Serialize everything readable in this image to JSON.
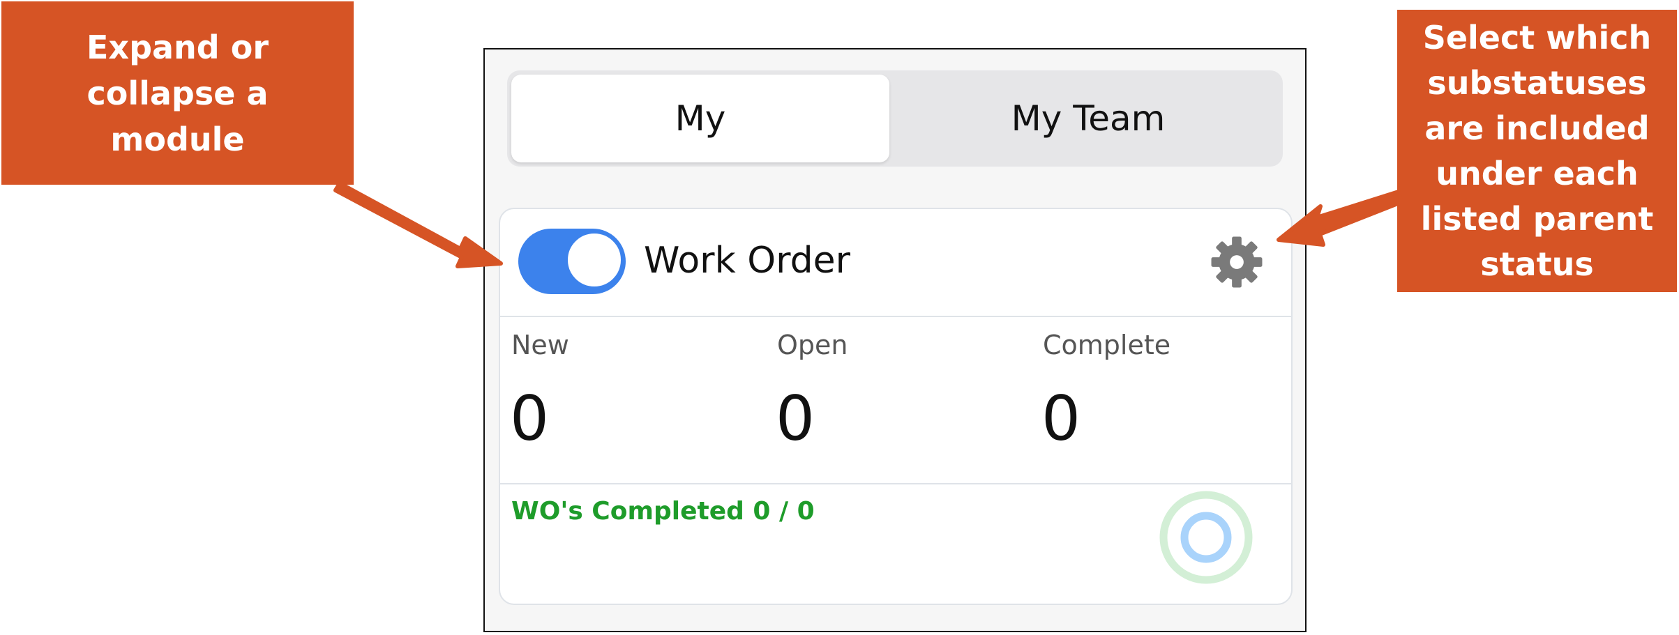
{
  "callouts": {
    "left": "Expand or collapse a module",
    "right": "Select which substatuses are included under each listed parent status"
  },
  "segmented": {
    "my_label": "My",
    "team_label": "My Team",
    "selected": "My"
  },
  "module": {
    "title": "Work Order",
    "toggle_on": true,
    "settings_icon": "gear-icon"
  },
  "stats": [
    {
      "label": "New",
      "value": "0"
    },
    {
      "label": "Open",
      "value": "0"
    },
    {
      "label": "Complete",
      "value": "0"
    }
  ],
  "footer": {
    "completed_text": "WO's Completed 0 / 0",
    "progress": 0
  },
  "colors": {
    "callout": "#d65425",
    "toggle": "#3c82ec",
    "completed_text": "#1e9c2a",
    "ring_outer": "#d3efd6",
    "ring_inner": "#a9d3fb"
  }
}
